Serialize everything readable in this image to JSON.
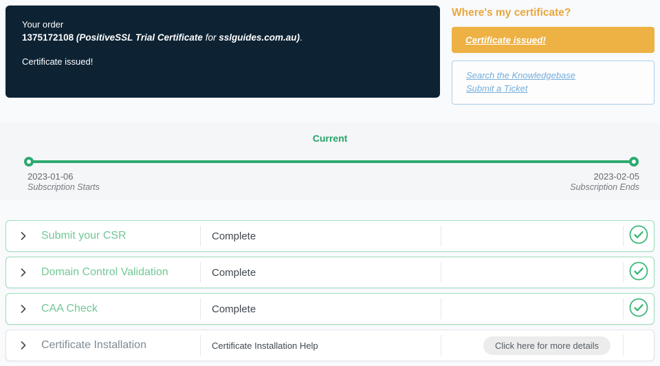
{
  "order_panel": {
    "label": "Your order",
    "order_id": "1375172108",
    "product": "(PositiveSSL Trial Certificate",
    "for_word": "for",
    "domain": "sslguides.com.au)",
    "period": ".",
    "status": "Certificate issued!"
  },
  "certificate_panel": {
    "heading": "Where's my certificate?",
    "issued_button_label": "Certificate issued!",
    "links": [
      {
        "label": "Search the Knowledgebase"
      },
      {
        "label": "Submit a Ticket"
      }
    ]
  },
  "timeline": {
    "current_label": "Current",
    "start": {
      "date": "2023-01-06",
      "label": "Subscription Starts"
    },
    "end": {
      "date": "2023-02-05",
      "label": "Subscription Ends"
    }
  },
  "steps": [
    {
      "title": "Submit your CSR",
      "status": "Complete",
      "done": true
    },
    {
      "title": "Domain Control Validation",
      "status": "Complete",
      "done": true
    },
    {
      "title": "CAA Check",
      "status": "Complete",
      "done": true
    },
    {
      "title": "Certificate Installation",
      "status": "Certificate Installation Help",
      "action_label": "Click here for more details",
      "done": false
    }
  ],
  "colors": {
    "dark_panel_bg": "#0d2334",
    "accent_orange": "#eaa63c",
    "button_yellow": "#edb144",
    "link_blue": "#74add9",
    "timeline_green": "#2ca96f",
    "step_title_green": "#72c795",
    "check_green": "#3cb878",
    "pending_gray": "#7e8a93"
  }
}
